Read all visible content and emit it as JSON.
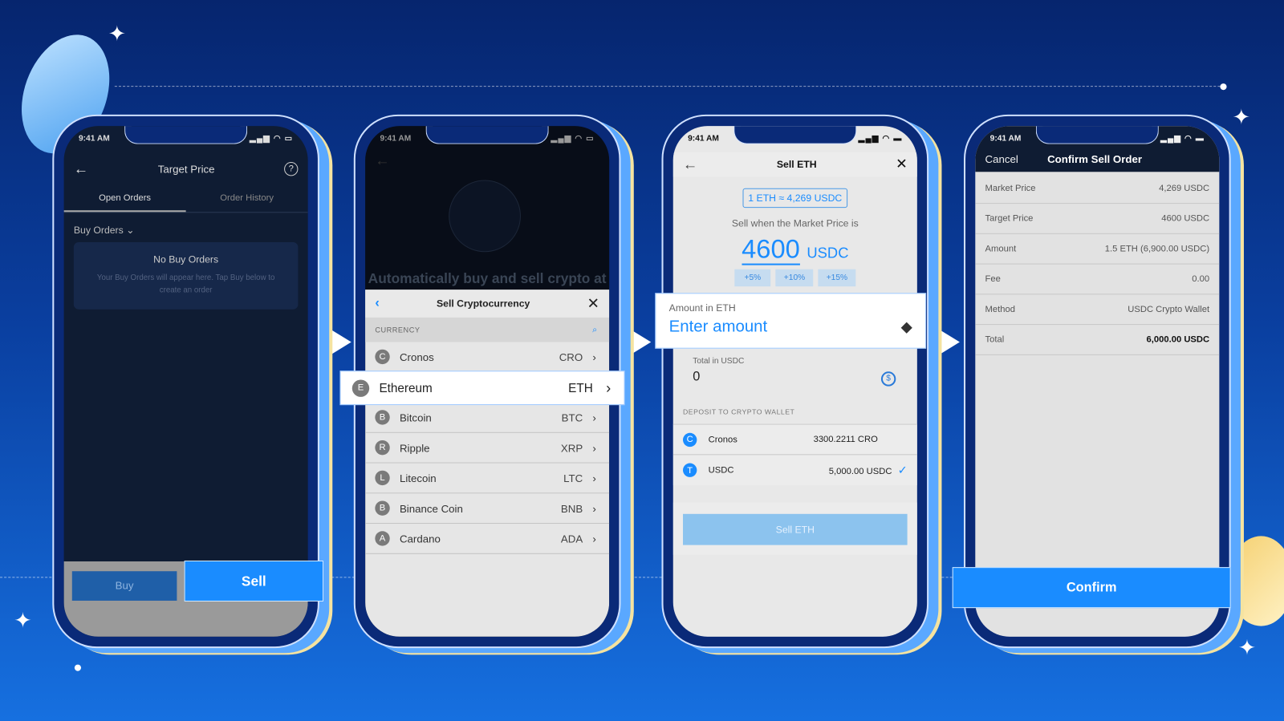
{
  "status_time": "9:41 AM",
  "screen1": {
    "title": "Target Price",
    "tabs": [
      "Open Orders",
      "Order History"
    ],
    "dropdown": "Buy Orders",
    "empty_title": "No Buy Orders",
    "empty_text": "Your Buy Orders will appear here. Tap Buy below to create an order",
    "buy": "Buy",
    "sell": "Sell"
  },
  "screen2": {
    "bg_text": "Automatically buy and sell crypto at your preferred price",
    "sheet_title": "Sell Cryptocurrency",
    "section": "CURRENCY",
    "currencies": [
      {
        "letter": "C",
        "name": "Cronos",
        "symbol": "CRO"
      },
      {
        "letter": "E",
        "name": "Ethereum",
        "symbol": "ETH"
      },
      {
        "letter": "B",
        "name": "Bitcoin",
        "symbol": "BTC"
      },
      {
        "letter": "R",
        "name": "Ripple",
        "symbol": "XRP"
      },
      {
        "letter": "L",
        "name": "Litecoin",
        "symbol": "LTC"
      },
      {
        "letter": "B",
        "name": "Binance Coin",
        "symbol": "BNB"
      },
      {
        "letter": "A",
        "name": "Cardano",
        "symbol": "ADA"
      }
    ]
  },
  "screen3": {
    "title": "Sell ETH",
    "rate": "1 ETH ≈ 4,269 USDC",
    "prompt": "Sell when the Market Price is",
    "price": "4600",
    "price_unit": "USDC",
    "chips": [
      "+5%",
      "+10%",
      "+15%"
    ],
    "amount_label": "Amount in ETH",
    "amount_placeholder": "Enter amount",
    "total_label": "Total in USDC",
    "total_value": "0",
    "deposit_label": "DEPOSIT TO CRYPTO WALLET",
    "wallets": [
      {
        "letter": "C",
        "name": "Cronos",
        "balance": "3300.2211 CRO"
      },
      {
        "letter": "T",
        "name": "USDC",
        "balance": "5,000.00 USDC",
        "selected": true
      }
    ],
    "button": "Sell ETH"
  },
  "screen4": {
    "cancel": "Cancel",
    "title": "Confirm Sell Order",
    "details": [
      {
        "label": "Market Price",
        "value": "4,269 USDC"
      },
      {
        "label": "Target Price",
        "value": "4600 USDC"
      },
      {
        "label": "Amount",
        "value": "1.5 ETH (6,900.00 USDC)"
      },
      {
        "label": "Fee",
        "value": "0.00"
      },
      {
        "label": "Method",
        "value": "USDC Crypto Wallet"
      },
      {
        "label": "Total",
        "value": "6,000.00 USDC"
      }
    ],
    "confirm": "Confirm"
  },
  "colors": {
    "accent": "#1a8cff",
    "dark_bg": "#0f1c33",
    "light_bg": "#e8e8e8"
  }
}
